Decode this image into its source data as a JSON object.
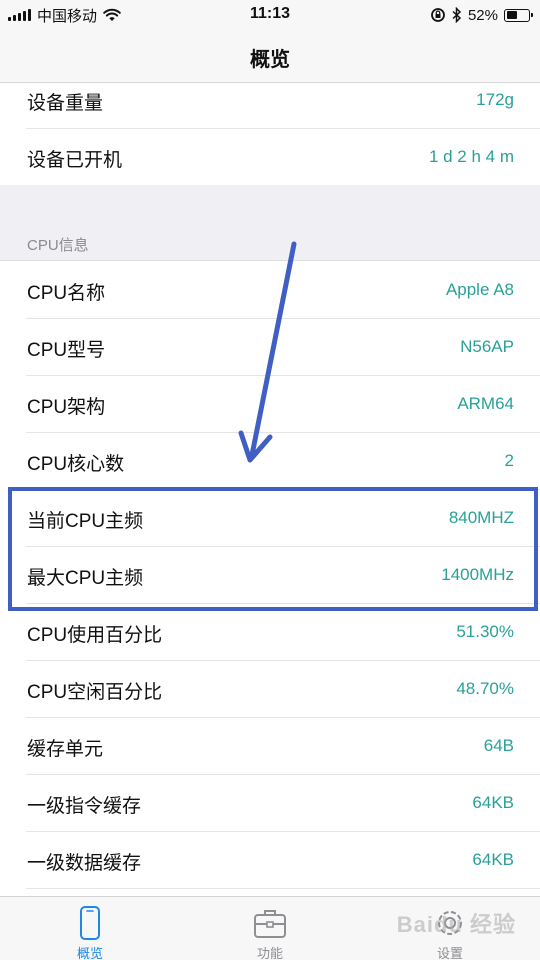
{
  "status_bar": {
    "carrier": "中国移动",
    "time": "11:13",
    "battery_percent": "52%",
    "battery_level": 0.52
  },
  "nav": {
    "title": "概览"
  },
  "device_rows": [
    {
      "label": "设备重量",
      "value": "172g"
    },
    {
      "label": "设备已开机",
      "value": "1 d 2 h 4 m"
    }
  ],
  "cpu_section": {
    "header": "CPU信息",
    "rows": [
      {
        "label": "CPU名称",
        "value": "Apple A8"
      },
      {
        "label": "CPU型号",
        "value": "N56AP"
      },
      {
        "label": "CPU架构",
        "value": "ARM64"
      },
      {
        "label": "CPU核心数",
        "value": "2"
      },
      {
        "label": "当前CPU主频",
        "value": "840MHZ"
      },
      {
        "label": "最大CPU主频",
        "value": "1400MHz"
      },
      {
        "label": "CPU使用百分比",
        "value": "51.30%"
      },
      {
        "label": "CPU空闲百分比",
        "value": "48.70%"
      },
      {
        "label": "缓存单元",
        "value": "64B"
      },
      {
        "label": "一级指令缓存",
        "value": "64KB"
      },
      {
        "label": "一级数据缓存",
        "value": "64KB"
      }
    ]
  },
  "tab_bar": {
    "tabs": [
      {
        "label": "概览",
        "icon": "phone-icon",
        "active": true
      },
      {
        "label": "功能",
        "icon": "toolbox-icon",
        "active": false
      },
      {
        "label": "设置",
        "icon": "gear-icon",
        "active": false
      }
    ]
  },
  "watermark": "Baidu 经验",
  "colors": {
    "value_text": "#2aa198",
    "active_tab": "#1f87e8",
    "annotation": "#3f5fc4",
    "section_background": "#efeff4"
  }
}
